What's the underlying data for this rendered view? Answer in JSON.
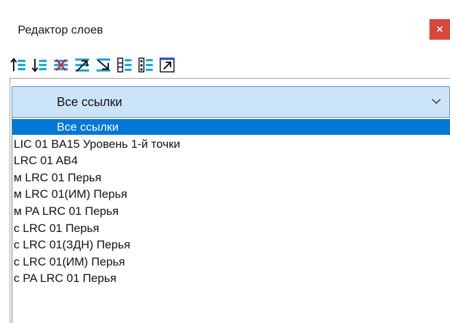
{
  "window": {
    "title": "Редактор слоев",
    "close_label": "×"
  },
  "toolbar": {
    "buttons": [
      {
        "name": "move-up-icon"
      },
      {
        "name": "move-down-icon"
      },
      {
        "name": "delete-layer-icon"
      },
      {
        "name": "move-top-icon"
      },
      {
        "name": "move-bottom-icon"
      },
      {
        "name": "list-collapse-icon"
      },
      {
        "name": "list-expand-icon"
      },
      {
        "name": "open-external-icon"
      }
    ]
  },
  "combo": {
    "value": "Все ссылки"
  },
  "dropdown": {
    "items": [
      {
        "label": "Все ссылки",
        "selected": true
      },
      {
        "label": "LIC 01 BA15 Уровень 1-й точки",
        "selected": false
      },
      {
        "label": "LRC 01 AB4",
        "selected": false
      },
      {
        "label": "м LRC 01 Перья",
        "selected": false
      },
      {
        "label": "м LRC 01(ИМ) Перья",
        "selected": false
      },
      {
        "label": "м PA LRC 01 Перья",
        "selected": false
      },
      {
        "label": "с LRC 01 Перья",
        "selected": false
      },
      {
        "label": "с LRC 01(ЗДН) Перья",
        "selected": false
      },
      {
        "label": "с LRC 01(ИМ) Перья",
        "selected": false
      },
      {
        "label": "с PA LRC 01 Перья",
        "selected": false
      }
    ]
  },
  "colors": {
    "accent": "#0078d7",
    "combo_bg": "#cce4f7",
    "close_bg": "#d9463b"
  }
}
